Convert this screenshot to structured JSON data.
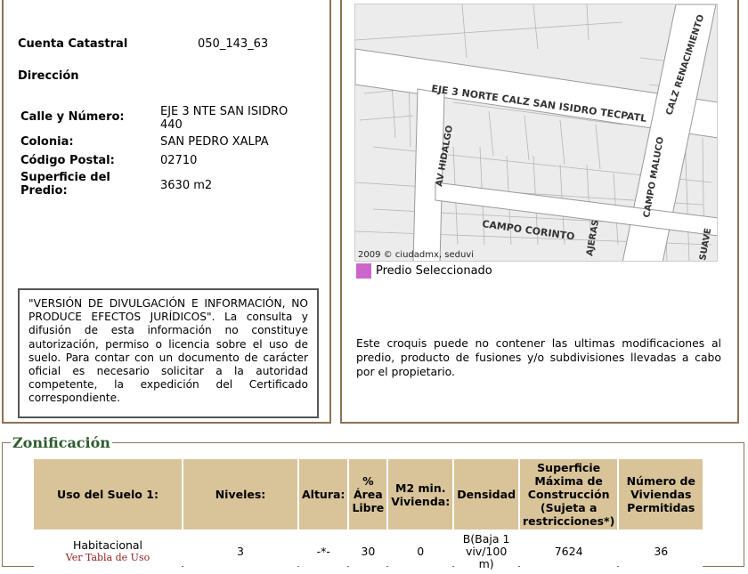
{
  "info": {
    "cuenta_label": "Cuenta Catastral",
    "cuenta_value": "050_143_63",
    "direccion_label": "Dirección",
    "calle_label": "Calle y Número:",
    "calle_value": "EJE 3 NTE SAN ISIDRO 440",
    "colonia_label": "Colonia:",
    "colonia_value": "SAN PEDRO XALPA",
    "cp_label": "Código Postal:",
    "cp_value": "02710",
    "superficie_label": "Superficie del Predio:",
    "superficie_value": "3630 m2"
  },
  "disclaimer": "\"VERSIÓN DE DIVULGACIÓN E INFORMACIÓN, NO PRODUCE EFECTOS JURÍDICOS\". La consulta y difusión de esta información no constituye autorización, permiso o licencia sobre el uso de suelo. Para contar con un documento de carácter oficial es necesario solicitar a la autoridad competente, la expedición del Certificado correspondiente.",
  "map": {
    "street1": "EJE 3 NORTE CALZ SAN ISIDRO TECPATL",
    "street2": "CALZ RENACIMIENTO",
    "street3": "AV HIDALGO",
    "street4": "CAMPO MALUCO",
    "street5": "CAMPO CORINTO",
    "street6": "AJERAS",
    "street7": "SUAVE",
    "credit": "2009 © ciudadmx, seduvi",
    "legend": "Predio Seleccionado",
    "legend_color": "#cc66cc",
    "note": "Este croquis puede no contener las ultimas modificaciones al predio, producto de fusiones y/o subdivisiones llevadas a cabo por el propietario."
  },
  "zonificacion": {
    "title": "Zonificación",
    "headers": [
      "Uso del Suelo 1:",
      "Niveles:",
      "Altura:",
      "% Área Libre",
      "M2 min. Vivienda:",
      "Densidad",
      "Superficie Máxima de Construcción (Sujeta a restricciones*)",
      "Número de Viviendas Permitidas"
    ],
    "row": {
      "uso": "Habitacional",
      "uso_link": "Ver Tabla de Uso",
      "niveles": "3",
      "altura": "-*-",
      "area_libre": "30",
      "m2_min": "0",
      "densidad": "B(Baja 1 viv/100 m)",
      "superficie": "7624",
      "viviendas": "36"
    }
  }
}
